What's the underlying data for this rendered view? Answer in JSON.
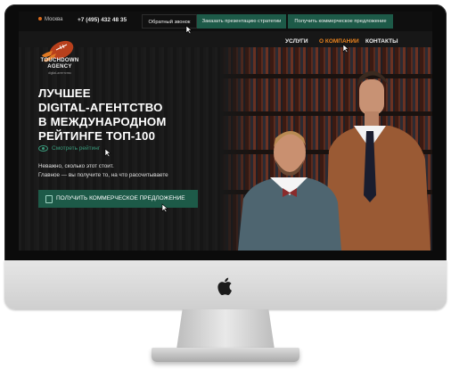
{
  "topbar": {
    "city": "Москва",
    "phone": "+7 (495) 432 48 35",
    "callback_label": "Обратный звонок",
    "strategy_label": "Заказать презентацию стратегии",
    "offer_label": "Получить коммерческое предложение"
  },
  "logo": {
    "name_line1": "TOUCHDOWN",
    "name_line2": "AGENCY",
    "tagline": "digital-агентство"
  },
  "nav": {
    "services": "УСЛУГИ",
    "about": "О КОМПАНИИ",
    "contacts": "КОНТАКТЫ"
  },
  "hero": {
    "headline_line1": "ЛУЧШЕЕ",
    "headline_line2": "DIGITAL-АГЕНТСТВО",
    "headline_line3": "В МЕЖДУНАРОДНОМ",
    "headline_line4": "РЕЙТИНГЕ ТОП-100",
    "rating_link": "Смотреть рейтинг",
    "subtext_line1": "Неважно, сколько этот стоит.",
    "subtext_line2": "Главное — вы получите то, на что рассчитываете",
    "cta_label": "ПОЛУЧИТЬ КОММЕРЧЕСКОЕ ПРЕДЛОЖЕНИЕ"
  },
  "colors": {
    "accent_green": "#1d5a48",
    "accent_orange": "#e8821e",
    "link_green": "#3a9a7c"
  },
  "icons": [
    "location-icon",
    "eye-icon",
    "document-icon",
    "cursor-icon",
    "apple-logo-icon"
  ]
}
